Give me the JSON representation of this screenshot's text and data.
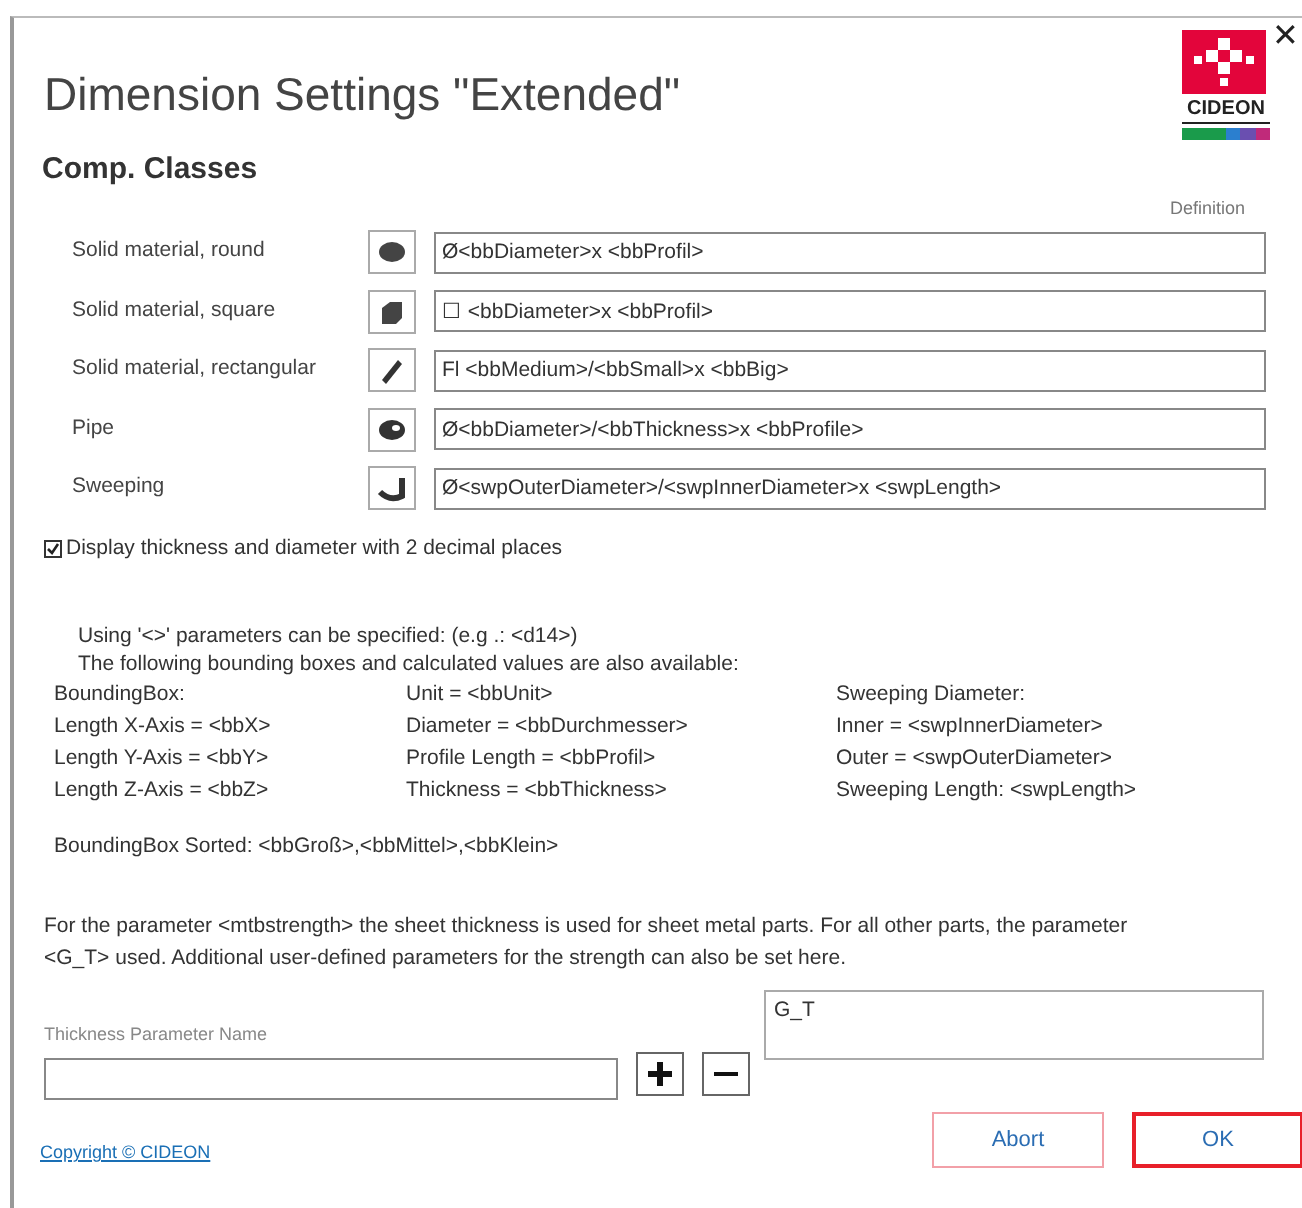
{
  "window": {
    "title": "Dimension Settings \"Extended\"",
    "close": "✕"
  },
  "logo": {
    "text": "CIDEON"
  },
  "section_title": "Comp. Classes",
  "definition_header": "Definition",
  "classes": [
    {
      "label": "Solid material, round",
      "kind": "round",
      "value": "Ø<bbDiameter>x <bbProfil>"
    },
    {
      "label": "Solid material, square",
      "kind": "square",
      "value": "☐ <bbDiameter>x <bbProfil>"
    },
    {
      "label": "Solid material, rectangular",
      "kind": "flat",
      "value": "Fl <bbMedium>/<bbSmall>x <bbBig>"
    },
    {
      "label": "Pipe",
      "kind": "pipe",
      "value": "Ø<bbDiameter>/<bbThickness>x <bbProfile>"
    },
    {
      "label": "Sweeping",
      "kind": "sweep",
      "value": "Ø<swpOuterDiameter>/<swpInnerDiameter>x <swpLength>"
    }
  ],
  "decimals_checkbox": {
    "label": "Display thickness and diameter with 2 decimal places",
    "checked": true
  },
  "info_lines": [
    "Using '<>' parameters can be specified: (e.g .: <d14>)",
    "The following bounding boxes and calculated values are also available:"
  ],
  "parameter_table": [
    [
      "BoundingBox:",
      "Unit = <bbUnit>",
      "Sweeping Diameter:"
    ],
    [
      "Length X-Axis = <bbX>",
      "Diameter = <bbDurchmesser>",
      "Inner = <swpInnerDiameter>"
    ],
    [
      "Length Y-Axis = <bbY>",
      "Profile Length = <bbProfil>",
      "Outer = <swpOuterDiameter>"
    ],
    [
      "Length Z-Axis = <bbZ>",
      "Thickness = <bbThickness>",
      "Sweeping Length: <swpLength>"
    ]
  ],
  "sorted_line": "BoundingBox Sorted: <bbGroß>,<bbMittel>,<bbKlein>",
  "strength_note": "For the parameter <mtbstrength> the sheet thickness is used for sheet metal parts. For all other parts, the parameter <G_T> used. Additional user-defined parameters for the strength can also be set here.",
  "thickness_field": {
    "label": "Thickness Parameter Name"
  },
  "thickness_list": [
    "G_T"
  ],
  "copyright": "Copyright © CIDEON",
  "buttons": [
    "Abort",
    "OK"
  ]
}
